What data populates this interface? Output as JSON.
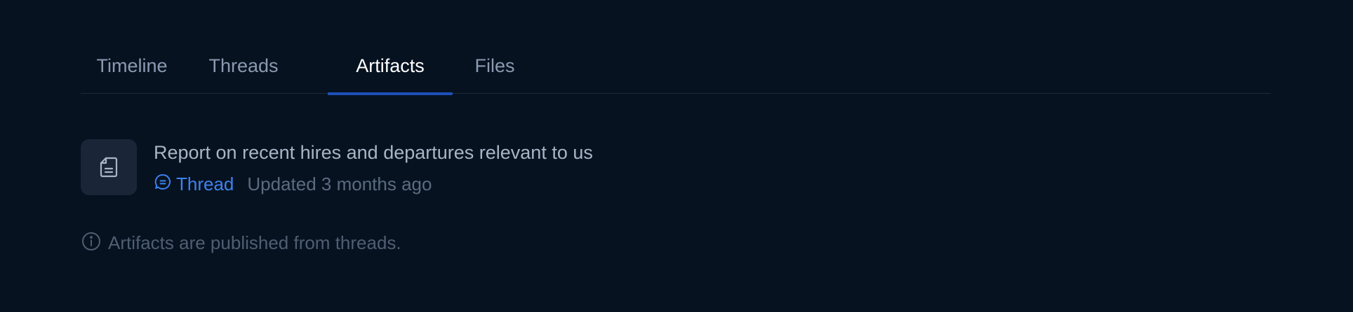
{
  "tabs": [
    {
      "label": "Timeline",
      "active": false
    },
    {
      "label": "Threads",
      "active": false
    },
    {
      "label": "Artifacts",
      "active": true
    },
    {
      "label": "Files",
      "active": false
    }
  ],
  "artifact": {
    "icon": "document-icon",
    "title": "Report on recent hires and departures relevant to us",
    "source_icon": "chat-bubble-icon",
    "source_label": "Thread",
    "updated": "Updated 3 months ago"
  },
  "note": {
    "icon": "info-icon",
    "text": "Artifacts are published from threads."
  },
  "colors": {
    "background": "#061220",
    "active_tab_underline": "#1e4fb8",
    "link": "#3d82f0"
  }
}
